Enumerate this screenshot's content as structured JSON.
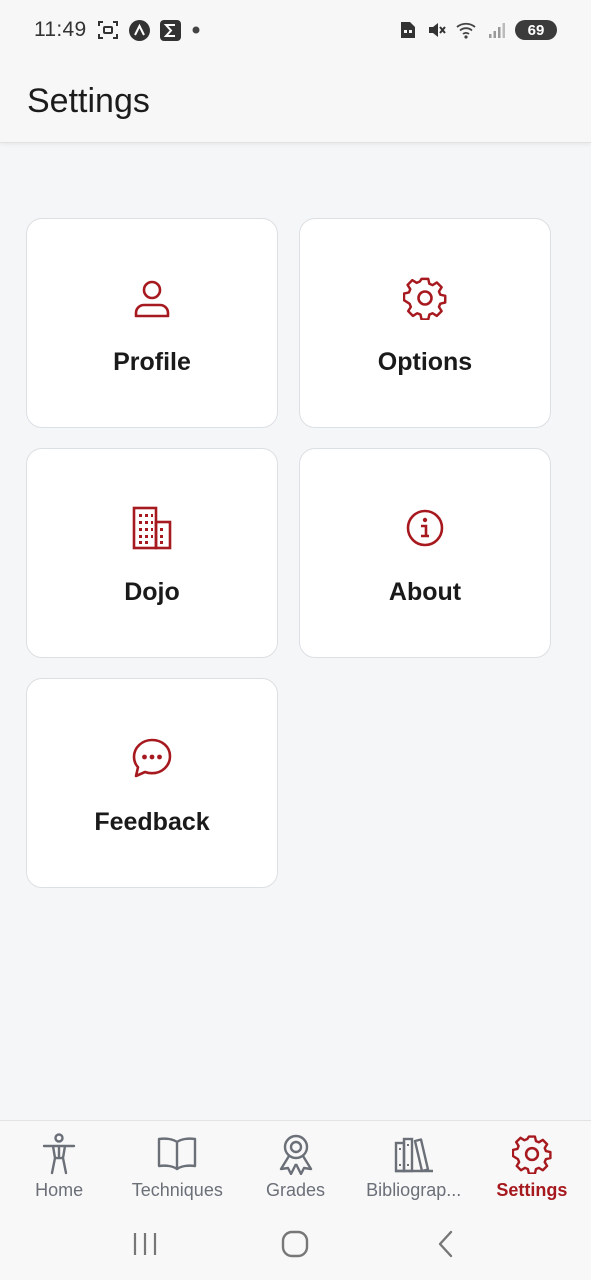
{
  "status_bar": {
    "time": "11:49",
    "battery": "69",
    "icons": [
      "screenshot-icon",
      "app-a-icon",
      "app-sigma-icon",
      "dot-icon",
      "sim-icon",
      "mute-icon",
      "wifi-icon",
      "signal-icon",
      "battery-icon"
    ]
  },
  "header": {
    "title": "Settings"
  },
  "cards": [
    {
      "label": "Profile",
      "icon": "person-icon"
    },
    {
      "label": "Options",
      "icon": "gear-icon"
    },
    {
      "label": "Dojo",
      "icon": "building-icon"
    },
    {
      "label": "About",
      "icon": "info-icon"
    },
    {
      "label": "Feedback",
      "icon": "chat-bubble-icon"
    }
  ],
  "bottom_nav": {
    "items": [
      {
        "label": "Home",
        "icon": "person-standing-icon"
      },
      {
        "label": "Techniques",
        "icon": "open-book-icon"
      },
      {
        "label": "Grades",
        "icon": "ribbon-award-icon"
      },
      {
        "label": "Bibliograp...",
        "icon": "books-icon"
      },
      {
        "label": "Settings",
        "icon": "gear-icon"
      }
    ],
    "active": "Settings"
  },
  "system_nav": [
    "recent-apps-icon",
    "home-icon",
    "back-icon"
  ],
  "colors": {
    "accent": "#a6191f",
    "inactive": "#6b6f78",
    "background": "#f5f6f8"
  }
}
